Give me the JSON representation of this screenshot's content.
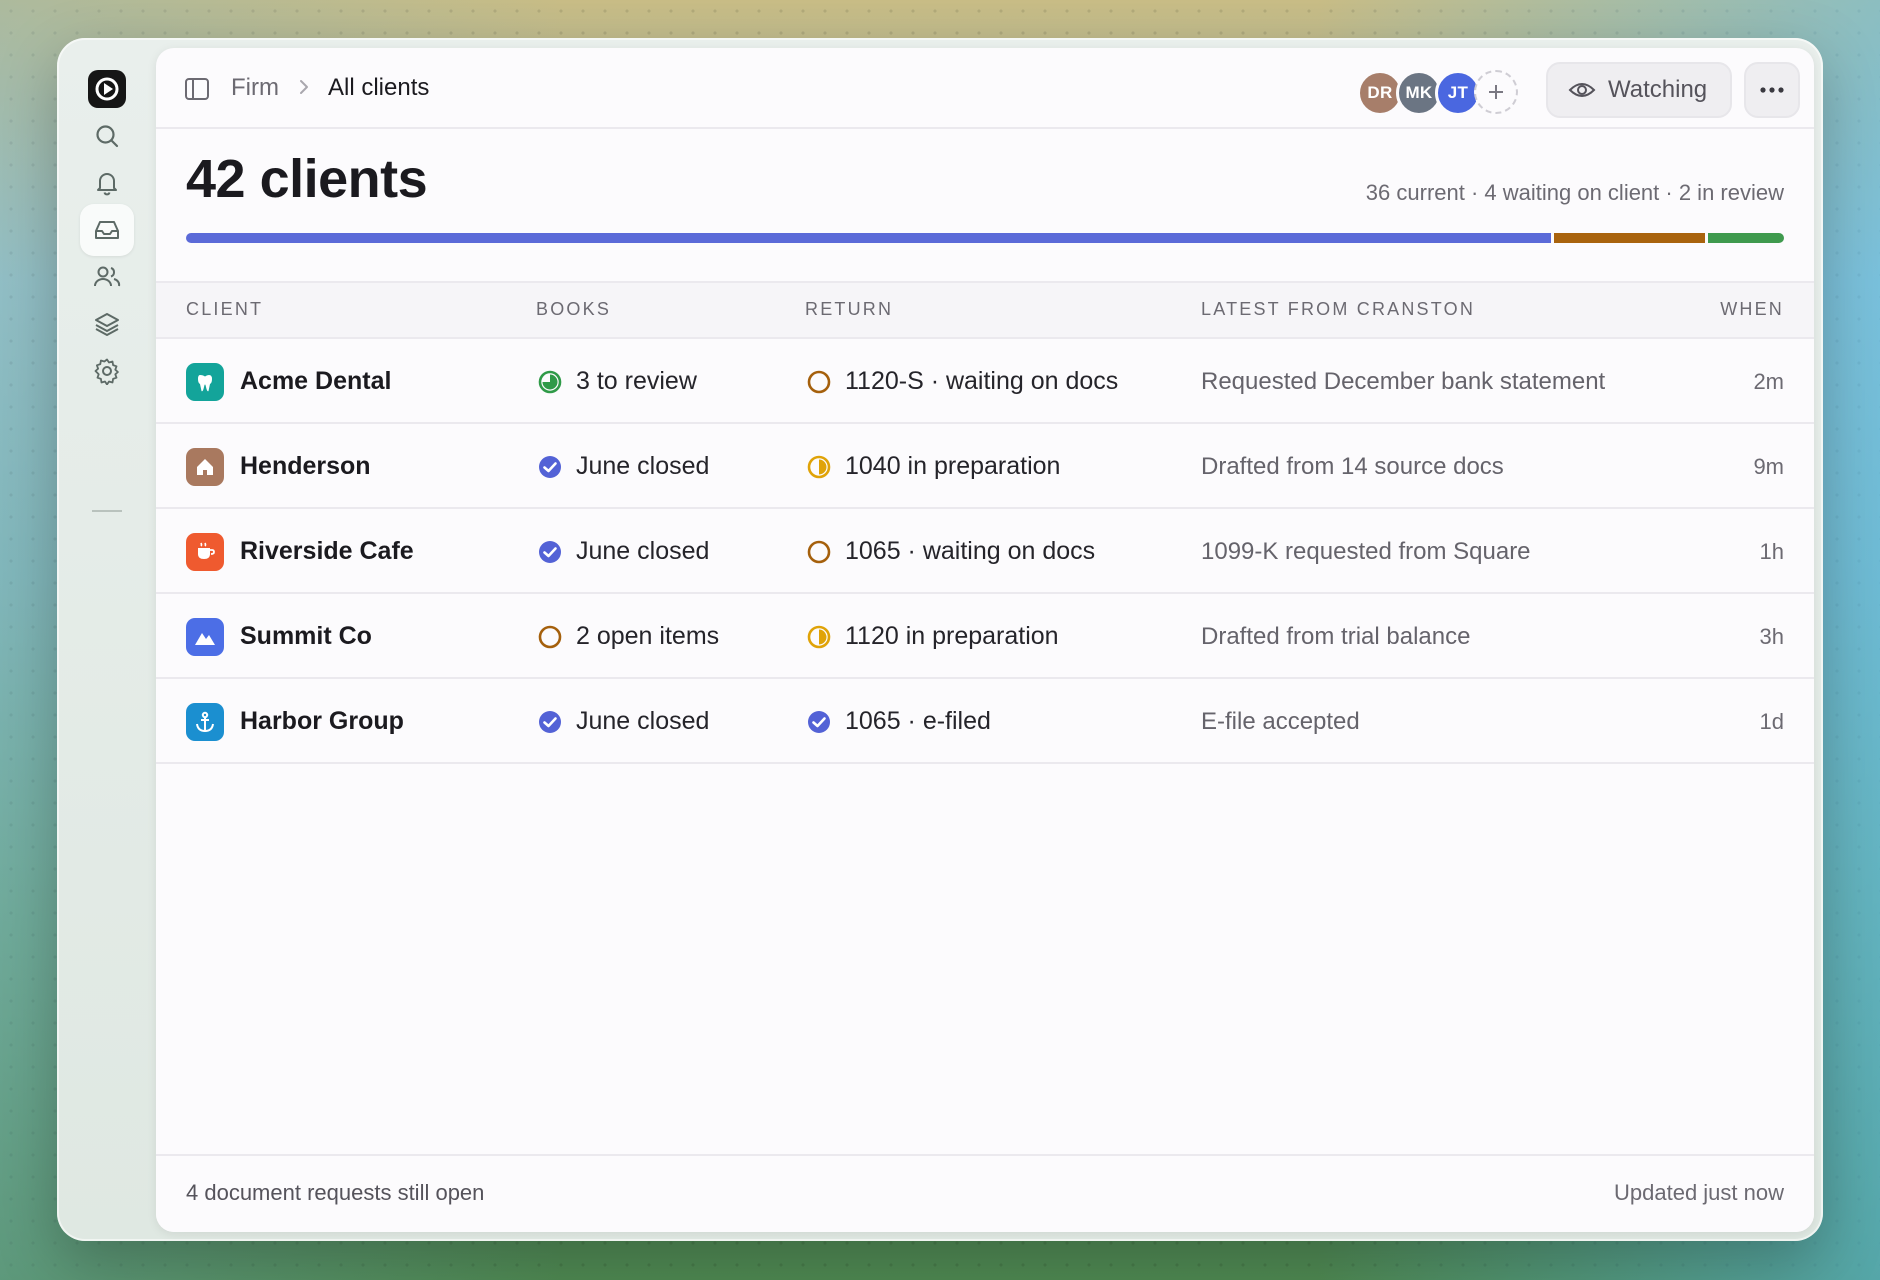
{
  "rail": {
    "logo": "app-logo",
    "items": [
      {
        "icon": "search-icon"
      },
      {
        "icon": "bell-icon"
      },
      {
        "icon": "inbox-icon",
        "active": true
      },
      {
        "icon": "users-icon"
      },
      {
        "icon": "layers-icon"
      },
      {
        "icon": "gear-icon"
      }
    ]
  },
  "breadcrumb": {
    "parent": "Firm",
    "current": "All clients"
  },
  "collaborators": [
    {
      "initials": "DR",
      "color": "#a77e6a"
    },
    {
      "initials": "MK",
      "color": "#6b7583"
    },
    {
      "initials": "JT",
      "color": "#4a67e0"
    }
  ],
  "watch_button": {
    "label": "Watching"
  },
  "header": {
    "title": "42 clients",
    "summary": "36 current · 4 waiting on client · 2 in review"
  },
  "progress": [
    {
      "label": "current",
      "value": 36,
      "color": "#5b6ad8"
    },
    {
      "label": "waiting on client",
      "value": 4,
      "color": "#a9630e"
    },
    {
      "label": "in review",
      "value": 2,
      "color": "#3f9a4e"
    }
  ],
  "table": {
    "columns": [
      "CLIENT",
      "BOOKS",
      "RETURN",
      "LATEST FROM CRANSTON",
      "WHEN"
    ],
    "rows": [
      {
        "client": "Acme Dental",
        "client_icon": "tooth-icon",
        "client_color": "#13a49a",
        "books": "3 to review",
        "books_status": "review",
        "return": "1120-S · waiting on docs",
        "return_status": "waiting",
        "latest": "Requested December bank statement",
        "when": "2m"
      },
      {
        "client": "Henderson",
        "client_icon": "house-icon",
        "client_color": "#a9795f",
        "books": "June closed",
        "books_status": "done",
        "return": "1040 in preparation",
        "return_status": "progress",
        "latest": "Drafted from 14 source docs",
        "when": "9m"
      },
      {
        "client": "Riverside Cafe",
        "client_icon": "coffee-icon",
        "client_color": "#ef5a2f",
        "books": "June closed",
        "books_status": "done",
        "return": "1065 · waiting on docs",
        "return_status": "waiting",
        "latest": "1099-K requested from Square",
        "when": "1h"
      },
      {
        "client": "Summit Co",
        "client_icon": "mountain-icon",
        "client_color": "#4c6ee6",
        "books": "2 open items",
        "books_status": "waiting",
        "return": "1120 in preparation",
        "return_status": "progress",
        "latest": "Drafted from trial balance",
        "when": "3h"
      },
      {
        "client": "Harbor Group",
        "client_icon": "anchor-icon",
        "client_color": "#1b8fd0",
        "books": "June closed",
        "books_status": "done",
        "return": "1065 · e-filed",
        "return_status": "done",
        "latest": "E-file accepted",
        "when": "1d"
      }
    ]
  },
  "footer": {
    "left": "4 document requests still open",
    "right": "Updated just now"
  }
}
